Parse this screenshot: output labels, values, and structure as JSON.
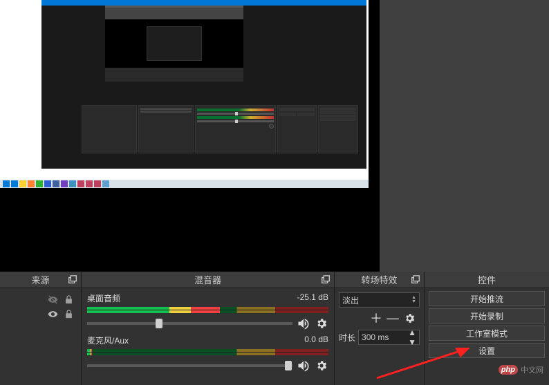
{
  "panels": {
    "sources": {
      "title": "来源"
    },
    "mixer": {
      "title": "混音器"
    },
    "transitions": {
      "title": "转场特效"
    },
    "controls": {
      "title": "控件"
    }
  },
  "mixer": {
    "channels": [
      {
        "name": "桌面音频",
        "db": "-25.1 dB",
        "level_pct": 55,
        "slider_pct": 35
      },
      {
        "name": "麦克风/Aux",
        "db": "0.0 dB",
        "level_pct": 2,
        "slider_pct": 98
      }
    ]
  },
  "transitions": {
    "selected": "淡出",
    "duration_label": "时长",
    "duration_value": "300 ms"
  },
  "controls": {
    "buttons": [
      "开始推流",
      "开始录制",
      "工作室模式",
      "设置"
    ]
  },
  "watermark": {
    "logo": "php",
    "text": "中文网"
  },
  "preview": {
    "taskbar_icons": [
      "#0078d7",
      "#0078d7",
      "#ffd030",
      "#ff8030",
      "#30b030",
      "#3060d0",
      "#4060a0",
      "#7040c0",
      "#4090c0",
      "#c04060",
      "#c04060",
      "#c04060",
      "#60a0d0"
    ]
  }
}
